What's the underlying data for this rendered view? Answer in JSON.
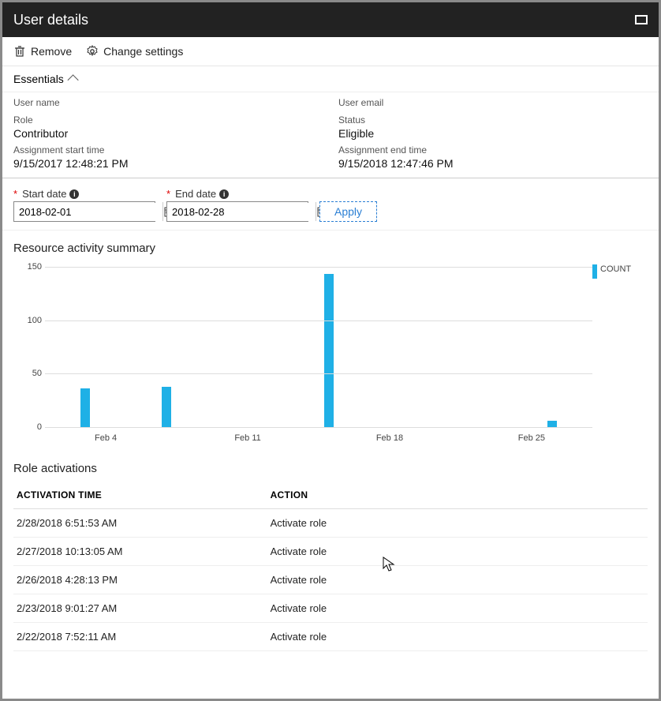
{
  "titlebar": {
    "title": "User details"
  },
  "toolbar": {
    "remove_label": "Remove",
    "settings_label": "Change settings"
  },
  "essentials": {
    "header": "Essentials",
    "user_name_label": "User name",
    "user_name_value": "",
    "user_email_label": "User email",
    "user_email_value": "",
    "role_label": "Role",
    "role_value": "Contributor",
    "status_label": "Status",
    "status_value": "Eligible",
    "start_label": "Assignment start time",
    "start_value": "9/15/2017 12:48:21 PM",
    "end_label": "Assignment end time",
    "end_value": "9/15/2018 12:47:46 PM"
  },
  "filter": {
    "start_label": "Start date",
    "start_value": "2018-02-01",
    "end_label": "End date",
    "end_value": "2018-02-28",
    "apply_label": "Apply"
  },
  "summary": {
    "title": "Resource activity summary",
    "legend": "COUNT"
  },
  "chart_data": {
    "type": "bar",
    "title": "Resource activity summary",
    "xlabel": "",
    "ylabel": "",
    "ylim": [
      0,
      155
    ],
    "y_ticks": [
      0,
      50,
      100,
      150
    ],
    "x_tick_labels": [
      "Feb 4",
      "Feb 11",
      "Feb 18",
      "Feb 25"
    ],
    "x_tick_days": [
      4,
      11,
      18,
      25
    ],
    "x_range_days": [
      1,
      28
    ],
    "series": [
      {
        "name": "COUNT",
        "color": "#1fb0e6",
        "points": [
          {
            "x_day": 3,
            "y": 36
          },
          {
            "x_day": 7,
            "y": 38
          },
          {
            "x_day": 15,
            "y": 143
          },
          {
            "x_day": 26,
            "y": 6
          }
        ]
      }
    ]
  },
  "activations": {
    "title": "Role activations",
    "columns": [
      "ACTIVATION TIME",
      "ACTION"
    ],
    "rows": [
      {
        "time": "2/28/2018 6:51:53 AM",
        "action": "Activate role"
      },
      {
        "time": "2/27/2018 10:13:05 AM",
        "action": "Activate role"
      },
      {
        "time": "2/26/2018 4:28:13 PM",
        "action": "Activate role"
      },
      {
        "time": "2/23/2018 9:01:27 AM",
        "action": "Activate role"
      },
      {
        "time": "2/22/2018 7:52:11 AM",
        "action": "Activate role"
      }
    ]
  }
}
